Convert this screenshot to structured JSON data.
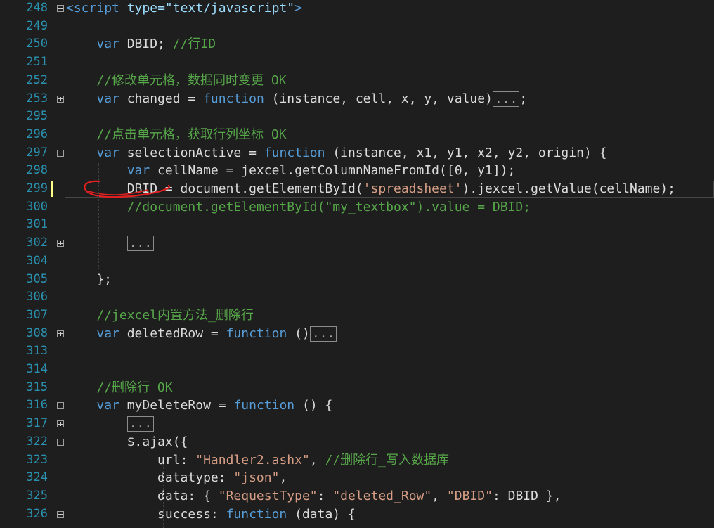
{
  "editor": {
    "lines": [
      {
        "num": "248",
        "fold": "open",
        "tokens": [
          {
            "t": "<",
            "c": "tag"
          },
          {
            "t": "script",
            "c": "tag"
          },
          {
            "t": " "
          },
          {
            "t": "type",
            "c": "attr"
          },
          {
            "t": "=\"text/javascript\"",
            "c": "attr"
          },
          {
            "t": ">",
            "c": "tag"
          }
        ]
      },
      {
        "num": "249",
        "tokens": []
      },
      {
        "num": "250",
        "tokens": [
          {
            "t": "    "
          },
          {
            "t": "var",
            "c": "kw"
          },
          {
            "t": " DBID; "
          },
          {
            "t": "//行ID",
            "c": "cm"
          }
        ]
      },
      {
        "num": "251",
        "tokens": []
      },
      {
        "num": "252",
        "tokens": [
          {
            "t": "    "
          },
          {
            "t": "//修改单元格，数据同时变更 OK",
            "c": "cm"
          }
        ]
      },
      {
        "num": "253",
        "fold": "collapsed",
        "tokens": [
          {
            "t": "    "
          },
          {
            "t": "var",
            "c": "kw"
          },
          {
            "t": " changed = "
          },
          {
            "t": "function",
            "c": "kw"
          },
          {
            "t": " (instance, cell, x, y, value)"
          },
          {
            "t": "...",
            "c": "ell"
          },
          {
            "t": ";"
          }
        ]
      },
      {
        "num": "295",
        "tokens": []
      },
      {
        "num": "296",
        "tokens": [
          {
            "t": "    "
          },
          {
            "t": "//点击单元格，获取行列坐标 OK",
            "c": "cm"
          }
        ]
      },
      {
        "num": "297",
        "fold": "open",
        "tokens": [
          {
            "t": "    "
          },
          {
            "t": "var",
            "c": "kw"
          },
          {
            "t": " selectionActive = "
          },
          {
            "t": "function",
            "c": "kw"
          },
          {
            "t": " (instance, x1, y1, x2, y2, origin) {"
          }
        ]
      },
      {
        "num": "298",
        "tokens": [
          {
            "t": "        "
          },
          {
            "t": "var",
            "c": "kw"
          },
          {
            "t": " cellName = jexcel.getColumnNameFromId([0, y1]);"
          }
        ]
      },
      {
        "num": "299",
        "modified": true,
        "tokens": [
          {
            "t": "        DBID = document.getElementById("
          },
          {
            "t": "'spreadsheet'",
            "c": "str"
          },
          {
            "t": ").jexcel.getValue(cellName);"
          }
        ]
      },
      {
        "num": "300",
        "tokens": [
          {
            "t": "        "
          },
          {
            "t": "//document.getElementById(\"my_textbox\").value = DBID;",
            "c": "cm"
          }
        ]
      },
      {
        "num": "301",
        "tokens": []
      },
      {
        "num": "302",
        "fold": "collapsed",
        "tokens": [
          {
            "t": "        "
          },
          {
            "t": "...",
            "c": "ell"
          }
        ]
      },
      {
        "num": "304",
        "tokens": []
      },
      {
        "num": "305",
        "tokens": [
          {
            "t": "    };"
          }
        ]
      },
      {
        "num": "306",
        "tokens": []
      },
      {
        "num": "307",
        "tokens": [
          {
            "t": "    "
          },
          {
            "t": "//jexcel内置方法_删除行",
            "c": "cm"
          }
        ]
      },
      {
        "num": "308",
        "fold": "collapsed",
        "tokens": [
          {
            "t": "    "
          },
          {
            "t": "var",
            "c": "kw"
          },
          {
            "t": " deletedRow = "
          },
          {
            "t": "function",
            "c": "kw"
          },
          {
            "t": " ()"
          },
          {
            "t": "...",
            "c": "ell"
          }
        ]
      },
      {
        "num": "313",
        "tokens": []
      },
      {
        "num": "314",
        "tokens": []
      },
      {
        "num": "315",
        "tokens": [
          {
            "t": "    "
          },
          {
            "t": "//删除行 OK",
            "c": "cm"
          }
        ]
      },
      {
        "num": "316",
        "fold": "open",
        "tokens": [
          {
            "t": "    "
          },
          {
            "t": "var",
            "c": "kw"
          },
          {
            "t": " myDeleteRow = "
          },
          {
            "t": "function",
            "c": "kw"
          },
          {
            "t": " () {"
          }
        ]
      },
      {
        "num": "317",
        "fold": "collapsed",
        "tokens": [
          {
            "t": "        "
          },
          {
            "t": "...",
            "c": "ell"
          }
        ]
      },
      {
        "num": "322",
        "fold": "open",
        "tokens": [
          {
            "t": "        $.ajax({"
          }
        ]
      },
      {
        "num": "323",
        "tokens": [
          {
            "t": "            url: "
          },
          {
            "t": "\"Handler2.ashx\"",
            "c": "str"
          },
          {
            "t": ", "
          },
          {
            "t": "//删除行_写入数据库",
            "c": "cm"
          }
        ]
      },
      {
        "num": "324",
        "tokens": [
          {
            "t": "            datatype: "
          },
          {
            "t": "\"json\"",
            "c": "str"
          },
          {
            "t": ","
          }
        ]
      },
      {
        "num": "325",
        "tokens": [
          {
            "t": "            data: { "
          },
          {
            "t": "\"RequestType\"",
            "c": "str"
          },
          {
            "t": ": "
          },
          {
            "t": "\"deleted_Row\"",
            "c": "str"
          },
          {
            "t": ", "
          },
          {
            "t": "\"DBID\"",
            "c": "str"
          },
          {
            "t": ": DBID },"
          }
        ]
      },
      {
        "num": "326",
        "fold": "open",
        "tokens": [
          {
            "t": "            success: "
          },
          {
            "t": "function",
            "c": "kw"
          },
          {
            "t": " (data) {"
          }
        ]
      }
    ]
  },
  "colors": {
    "background": "#1e1e1e",
    "line_number": "#2b91af",
    "keyword": "#569cd6",
    "string": "#d69d85",
    "comment": "#57a64a",
    "annotation": "#e02020"
  }
}
